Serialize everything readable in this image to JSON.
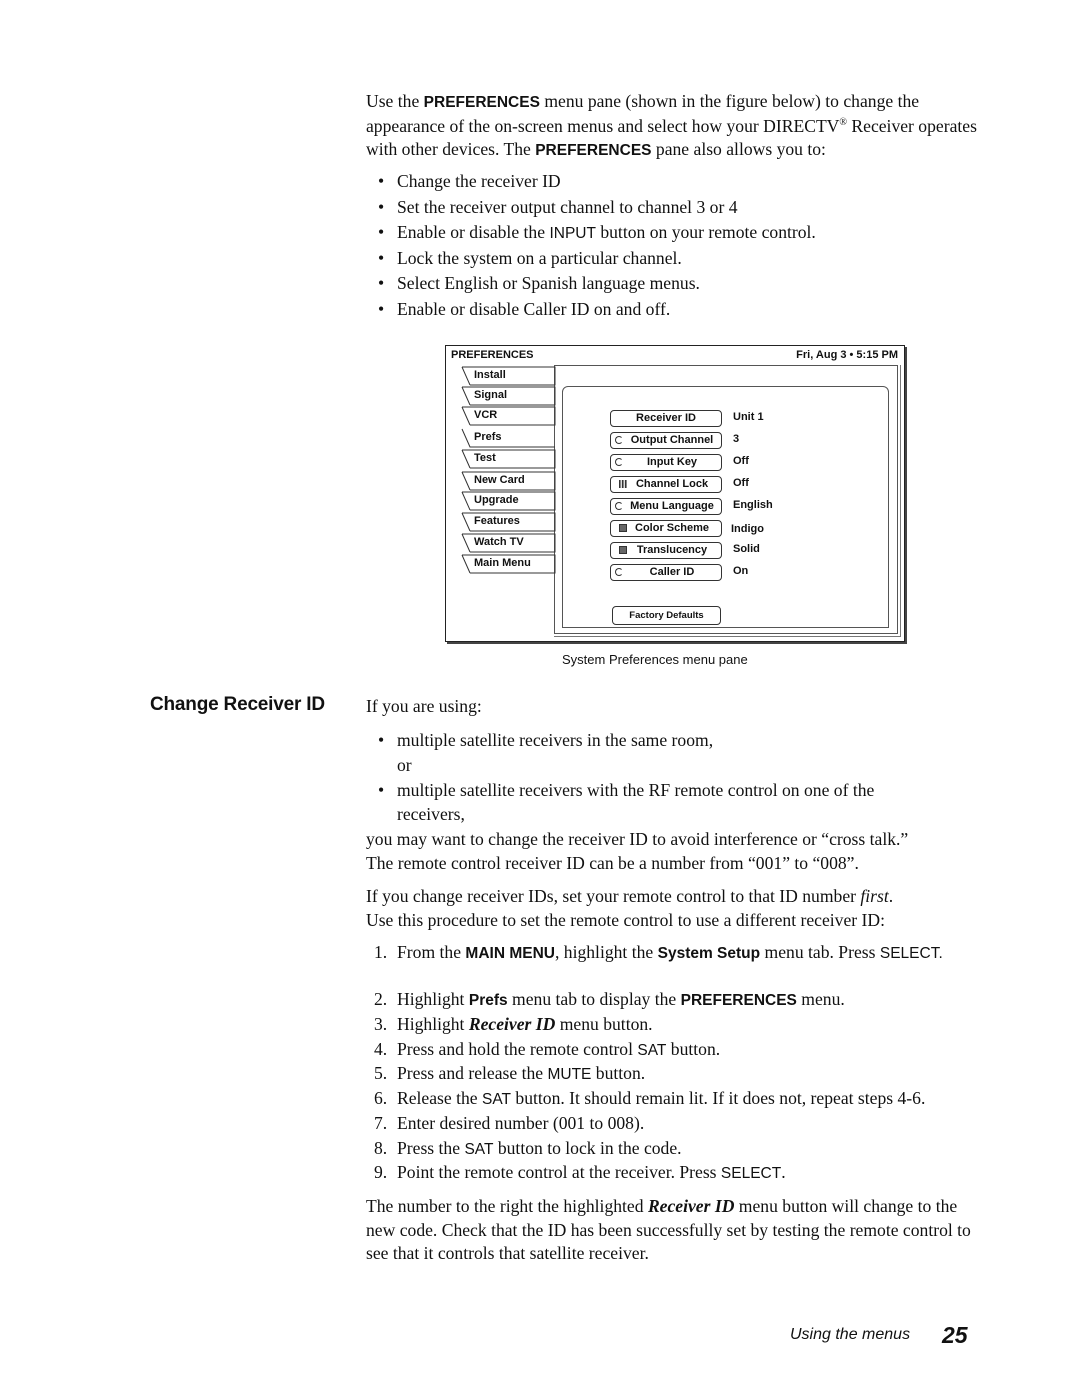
{
  "intro": {
    "part1": "Use the ",
    "kw1": "PREFERENCES",
    "part2": " menu pane (shown in the figure below) to change the appearance of the on-screen menus and select how your DIRECTV",
    "reg": "®",
    "part3": " Receiver operates with other devices. The ",
    "kw2": "PREFERENCES",
    "part4": " pane also allows you to:"
  },
  "intro_bullets": [
    {
      "pre": "Change the receiver ID",
      "kw": "",
      "post": ""
    },
    {
      "pre": "Set the receiver output channel to channel 3 or 4",
      "kw": "",
      "post": ""
    },
    {
      "pre": "Enable or disable the ",
      "kw": "INPUT",
      "post": " button on your remote control."
    },
    {
      "pre": "Lock the system on a particular channel.",
      "kw": "",
      "post": ""
    },
    {
      "pre": "Select English or Spanish language menus.",
      "kw": "",
      "post": ""
    },
    {
      "pre": "Enable or disable Caller ID on and off.",
      "kw": "",
      "post": ""
    }
  ],
  "bullet_char": "•",
  "figure": {
    "title": "PREFERENCES",
    "datetime": "Fri, Aug 3  •  5:15 PM",
    "tabs": [
      "Install",
      "Signal",
      "VCR",
      "Prefs",
      "Test",
      "New Card",
      "Upgrade",
      "Features",
      "Watch TV",
      "Main Menu"
    ],
    "active_tab": "Prefs",
    "menu_items": [
      {
        "label": "Receiver ID",
        "icon": "none",
        "value": "Unit 1"
      },
      {
        "label": "Output Channel",
        "icon": "cycle-icon",
        "value": "3"
      },
      {
        "label": "Input Key",
        "icon": "cycle-icon",
        "value": "Off"
      },
      {
        "label": "Channel Lock",
        "icon": "grid-icon",
        "value": "Off"
      },
      {
        "label": "Menu Language",
        "icon": "cycle-icon",
        "value": "English"
      },
      {
        "label": "Color Scheme",
        "icon": "list-icon",
        "value": "Indigo"
      },
      {
        "label": "Translucency",
        "icon": "list-icon",
        "value": "Solid"
      },
      {
        "label": "Caller ID",
        "icon": "cycle-icon",
        "value": "On"
      }
    ],
    "factory_defaults": "Factory Defaults",
    "caption": "System Preferences menu pane"
  },
  "section": {
    "heading": "Change Receiver ID",
    "lead": "If you are using:",
    "bullets": [
      "multiple satellite receivers in the same room,",
      "multiple satellite receivers with the RF remote control on one of the receivers,"
    ],
    "or_text": "or",
    "para1_line1": "you may want to change the receiver ID to avoid interference or “cross talk.”",
    "para1_line2": "The remote control receiver ID can be a number from “001” to “008”.",
    "para2_a": "If you change receiver IDs, set your remote control to that ID number ",
    "para2_em": "first",
    "para2_b": ".",
    "para2_line2": "Use this procedure to set the remote control to use a different receiver ID:",
    "steps": [
      {
        "num": "1.",
        "parts": [
          [
            "r",
            "From the "
          ],
          [
            "b",
            "MAIN MENU"
          ],
          [
            "r",
            ", highlight the "
          ],
          [
            "b",
            "System Setup"
          ],
          [
            "r",
            " menu tab. Press "
          ],
          [
            "s",
            "SELECT."
          ]
        ]
      },
      {
        "num": "2.",
        "parts": [
          [
            "r",
            "Highlight "
          ],
          [
            "b",
            "Prefs"
          ],
          [
            "r",
            " menu tab to display the "
          ],
          [
            "b",
            "PREFERENCES"
          ],
          [
            "r",
            " menu."
          ]
        ]
      },
      {
        "num": "3.",
        "parts": [
          [
            "r",
            "Highlight "
          ],
          [
            "bi",
            "Receiver ID"
          ],
          [
            "r",
            " menu button."
          ]
        ]
      },
      {
        "num": "4.",
        "parts": [
          [
            "r",
            "Press and hold the remote control "
          ],
          [
            "s",
            "SAT"
          ],
          [
            "r",
            " button."
          ]
        ]
      },
      {
        "num": "5.",
        "parts": [
          [
            "r",
            "Press and release the "
          ],
          [
            "s",
            "MUTE"
          ],
          [
            "r",
            " button."
          ]
        ]
      },
      {
        "num": "6.",
        "parts": [
          [
            "r",
            "Release the "
          ],
          [
            "s",
            "SAT"
          ],
          [
            "r",
            " button. It should remain lit. If it does not, repeat steps 4-6."
          ]
        ]
      },
      {
        "num": "7.",
        "parts": [
          [
            "r",
            "Enter desired number (001 to 008)."
          ]
        ]
      },
      {
        "num": "8.",
        "parts": [
          [
            "r",
            "Press the "
          ],
          [
            "s",
            "SAT"
          ],
          [
            "r",
            " button to lock in the code."
          ]
        ]
      },
      {
        "num": "9.",
        "parts": [
          [
            "r",
            "Point the remote control at the receiver. Press "
          ],
          [
            "s",
            "SELECT"
          ],
          [
            "r",
            "."
          ]
        ]
      }
    ],
    "closing_a": "The number to the right the highlighted ",
    "closing_em": "Receiver ID",
    "closing_b": " menu button will change to the new code. Check that the ID has been successfully set by testing the remote control to see that it controls that satellite receiver."
  },
  "footer": {
    "section_label": "Using the menus",
    "page_number": "25"
  }
}
